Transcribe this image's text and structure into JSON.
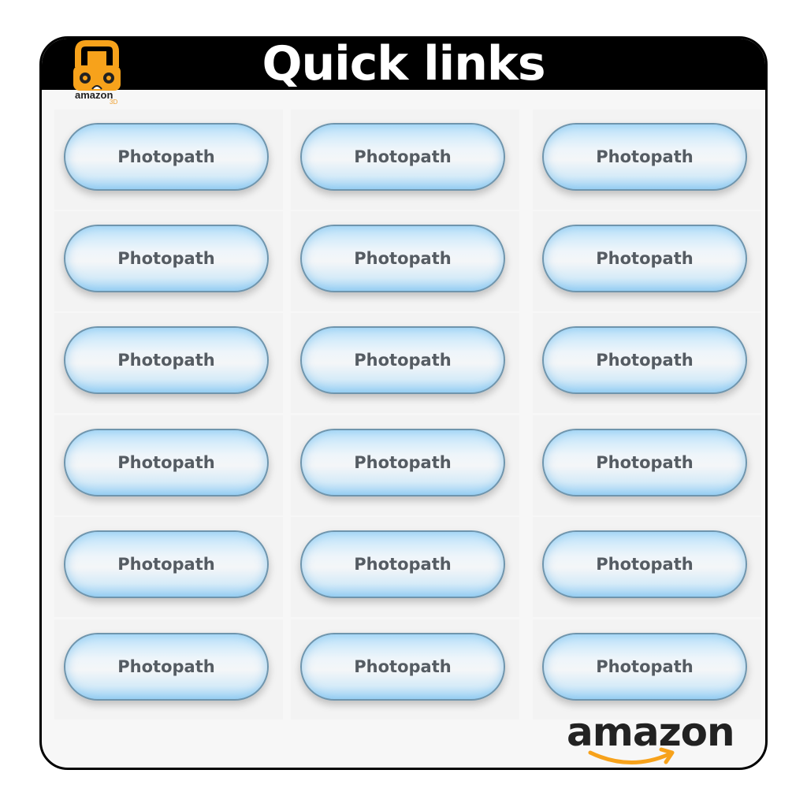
{
  "header": {
    "title": "Quick links"
  },
  "brand_badge": {
    "text": "amazon",
    "sub": "3D",
    "icon": "vr-headset-icon"
  },
  "links": [
    {
      "label": "Photopath"
    },
    {
      "label": "Photopath"
    },
    {
      "label": "Photopath"
    },
    {
      "label": "Photopath"
    },
    {
      "label": "Photopath"
    },
    {
      "label": "Photopath"
    },
    {
      "label": "Photopath"
    },
    {
      "label": "Photopath"
    },
    {
      "label": "Photopath"
    },
    {
      "label": "Photopath"
    },
    {
      "label": "Photopath"
    },
    {
      "label": "Photopath"
    },
    {
      "label": "Photopath"
    },
    {
      "label": "Photopath"
    },
    {
      "label": "Photopath"
    },
    {
      "label": "Photopath"
    },
    {
      "label": "Photopath"
    },
    {
      "label": "Photopath"
    }
  ],
  "footer_logo": {
    "text": "amazon",
    "icon": "smile-arrow-icon"
  },
  "colors": {
    "header": "#000000",
    "pill_border": "#6f95ad",
    "pill_glow": "#a6d6f6",
    "label": "#555c63",
    "amazon_orange": "#f7a21b"
  }
}
